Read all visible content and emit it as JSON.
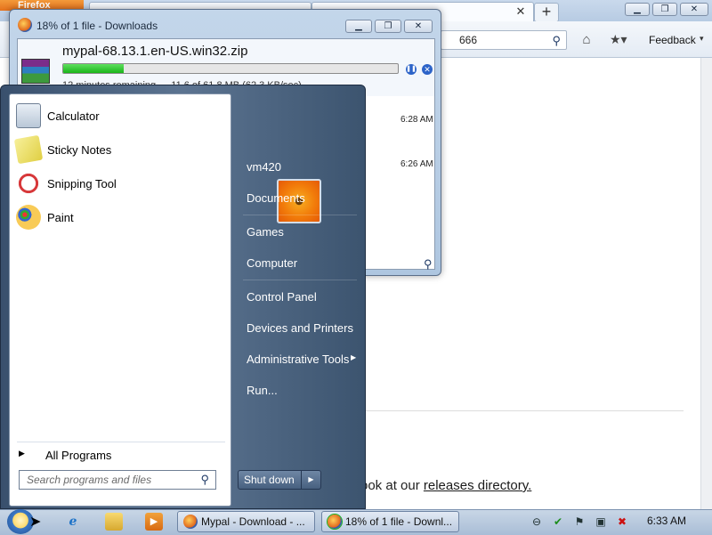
{
  "firefox": {
    "menu_label": "Firefox",
    "url_text": "666",
    "new_tab": "+",
    "tab_close": "✕",
    "feedback": "Feedback",
    "feedback_arrow": "▾",
    "content_fragment": "l",
    "content_text_prefix": "ook at our ",
    "content_link": "releases directory.",
    "window_buttons": {
      "minimize": "▁",
      "maximize": "❐",
      "close": "✕"
    },
    "icons": {
      "home": "⌂",
      "bookmarks": "★▾",
      "search": "⚲"
    }
  },
  "downloads": {
    "title": "18% of 1 file - Downloads",
    "filename": "mypal-68.13.1.en-US.win32.zip",
    "progress_percent": 18,
    "status": "12 minutes remaining — 11.6 of 61.8 MB (62.3 KB/sec)",
    "item_times": [
      "6:28 AM",
      "6:26 AM"
    ],
    "buttons": {
      "pause": "❚❚",
      "cancel": "✕"
    },
    "window_buttons": {
      "minimize": "▁",
      "maximize": "❐",
      "close": "✕"
    }
  },
  "start_menu": {
    "programs": [
      "Calculator",
      "Sticky Notes",
      "Snipping Tool",
      "Paint"
    ],
    "all_programs": "All Programs",
    "search_placeholder": "Search programs and files",
    "user_name": "vm420",
    "right_items": [
      "Documents",
      "Games",
      "Computer",
      "Control Panel",
      "Devices and Printers",
      "Administrative Tools",
      "Run..."
    ],
    "shutdown": "Shut down",
    "arrow": "▶"
  },
  "taskbar": {
    "tasks": [
      "Mypal - Download - ...",
      "18% of 1 file - Downl..."
    ],
    "clock": "6:33 AM",
    "pinned": {
      "ie": "e",
      "media": "▶"
    },
    "tray": [
      "⊖",
      "✔",
      "⚑",
      "▣",
      "✖"
    ]
  }
}
